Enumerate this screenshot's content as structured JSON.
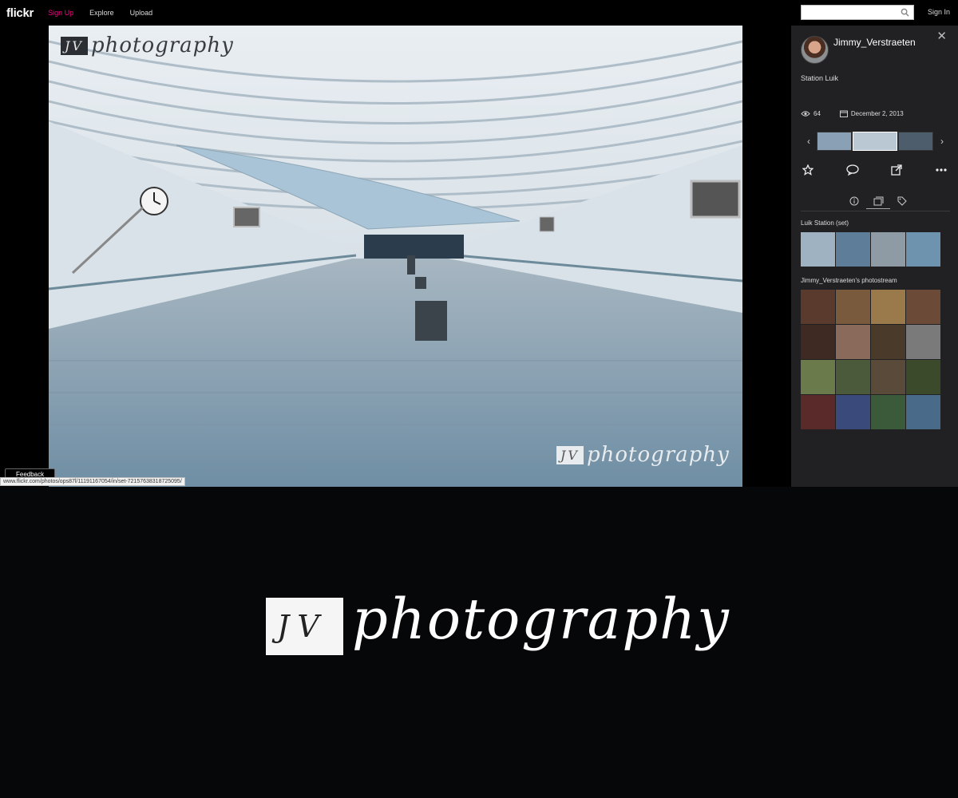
{
  "nav": {
    "logo": "flickr",
    "signup": "Sign Up",
    "explore": "Explore",
    "upload": "Upload"
  },
  "photo": {
    "watermark_box": "JV",
    "watermark_script": "photography"
  },
  "feedback_label": "Feedback",
  "status_url": "www.flickr.com/photos/ops87l/11191167054/in/set-72157638318725095/",
  "panel": {
    "search_placeholder": "",
    "signin": "Sign In",
    "close_icon": "close-icon",
    "username": "Jimmy_Verstraeten",
    "title": "Station Luik",
    "views": "64",
    "date": "December 2, 2013",
    "set_label": "Luik Station (set)",
    "stream_label": "Jimmy_Verstraeten's photostream",
    "thumb_colors": [
      "#8aa0b4",
      "#b9c8d3",
      "#4e5d6b"
    ],
    "set_colors": [
      "#9fb2c2",
      "#5d7d99",
      "#8e9aa4",
      "#6d93ae"
    ],
    "stream_colors": [
      "#5a3a2c",
      "#7a5a3c",
      "#9a7a4a",
      "#6b4a38",
      "#3e2a22",
      "#8a6a5a",
      "#4a3a2a",
      "#7a7a7a",
      "#6a7a4a",
      "#4a5a3a",
      "#5a4a3a",
      "#3a4a2a",
      "#5a2a2a",
      "#3a4a7a",
      "#3a5a3a",
      "#4a6a8a"
    ]
  },
  "big_logo": {
    "box": "JV",
    "script": "photography"
  }
}
